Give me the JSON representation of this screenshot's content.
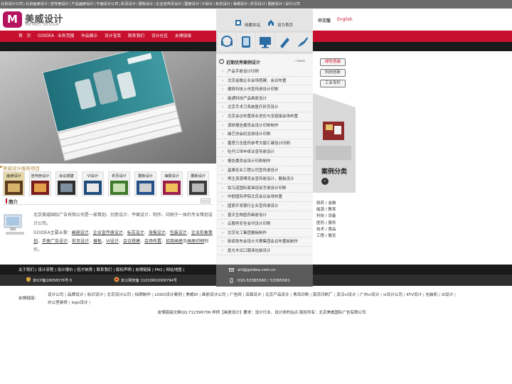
{
  "topbar": {
    "links": [
      "北京设计公司",
      "北京画册设计",
      "宣传册设计",
      "产品画册设计",
      "平面设计公司",
      "彩页设计",
      "展板设计",
      "企业宣传页设计",
      "图册设计",
      "VI设计",
      "标志设计",
      "海报设计",
      "折页设计",
      "图册设计",
      "设计公司"
    ]
  },
  "header": {
    "logo_mark": "M",
    "logo_cn": "美威设计",
    "logo_en": "MEIWEI DESIGN",
    "favorite": "收藏本站",
    "homepage": "设为首页",
    "lang_cn": "中文版",
    "lang_en": "English"
  },
  "nav": {
    "items": [
      "首　页",
      "GOIDEA",
      "业务范围",
      "作品展示",
      "设计宝库",
      "联系我们",
      "设计社区",
      "友情链接"
    ]
  },
  "cases": {
    "title": "近期优秀案例设计",
    "more": "more",
    "items": [
      "产品手册设计印刷",
      "北京金融企业会场搭建、会议布置",
      "建筑科技上市宣传册设计印刷",
      "能通科技产品画册设计",
      "北京手术刀系统医疗折页设计",
      "北京会议布置商业进化与全链接会场布置",
      "调研报告委员会设计印刷制作",
      "曲艺协会纪念册设计印刷",
      "嘉思万全医药参考文献汇编设计印刷",
      "牡丹江恒丰纸业宣传册设计",
      "报告委员会设计印刷制作",
      "昌泰宏业工程公司宣传册设计",
      "再生资源博览会宣传册设计，展板设计",
      "钛马道国际家具培训手册设计印刷",
      "中欧国际学院北京会议会场布置",
      "国家开发银行企业宣传册设计",
      "普天生物医药画册设计",
      "云服务安全会刊设计印刷",
      "北京化工集团展板制作",
      "新闻发布会设计大赛集团会议布置板制作",
      "复方木瓜口服液包装设计"
    ]
  },
  "tags": [
    "绿色低碳",
    "科技创新",
    "工业专栏"
  ],
  "case_class": "案例分类",
  "categories": [
    "政府 / 金融",
    "能源 / 教育",
    "科技 / 设备",
    "医药 / 服务",
    "技术 / 食品",
    "工程 / 展览"
  ],
  "services": {
    "title": "美威设计服务项目",
    "tabs": [
      "画册设计",
      "宣传册设计",
      "会议搭建",
      "VI设计",
      "折页设计",
      "展板设计",
      "海报设计",
      "展板设计"
    ]
  },
  "intro": {
    "title": "简介",
    "more": "more",
    "para1": "北京美威国际广告有限公司是一家策划、创意设计、平面设计、制作、印刷于一体的专业策划设计公司。",
    "para2_lead": "GOIDEA主要从事：",
    "services": [
      "画册设计",
      "企业宣传册设计",
      "标志设计",
      "海报设计",
      "包装设计",
      "企业形象策划",
      "手册广告设计",
      "彩页设计",
      "展板",
      "VI设计",
      "会议搭建",
      "会场布置",
      "招商画册",
      "画册印刷"
    ],
    "para2_tail": "制作。"
  },
  "footer": {
    "links": [
      "关于我们",
      "设计流程",
      "设计报价",
      "招才纳贤",
      "联系我们",
      "版权声明",
      "友情链接",
      "FAQ",
      "网站地图"
    ],
    "icp1": "京ICP备18058376号-5",
    "icp2": "京公网安备 11010602006794号",
    "email": "art@goidea.com.cn",
    "phone": "010-53365560 / 53365561"
  },
  "friends": {
    "label": "友情链接：",
    "items": [
      "设计公司",
      "品牌设计",
      "标识设计",
      "北京设计公司",
      "标牌制作",
      "LOGO设计案例",
      "美威ID",
      "画册设计公司",
      "广告网",
      "店面设计",
      "北京产品设计",
      "青岛印刷",
      "南京印刷厂",
      "武汉vi设计",
      "广州vi设计",
      "vi设计公司",
      "KTV设计",
      "包装机",
      "SI设计",
      "办公室装修",
      "logo设计"
    ]
  },
  "copyright": "友情链接交换QQ:712396706 样例【画册设计】要求：设计行业、设计类的站点 版权所有：北京美威国际广告有限公司"
}
